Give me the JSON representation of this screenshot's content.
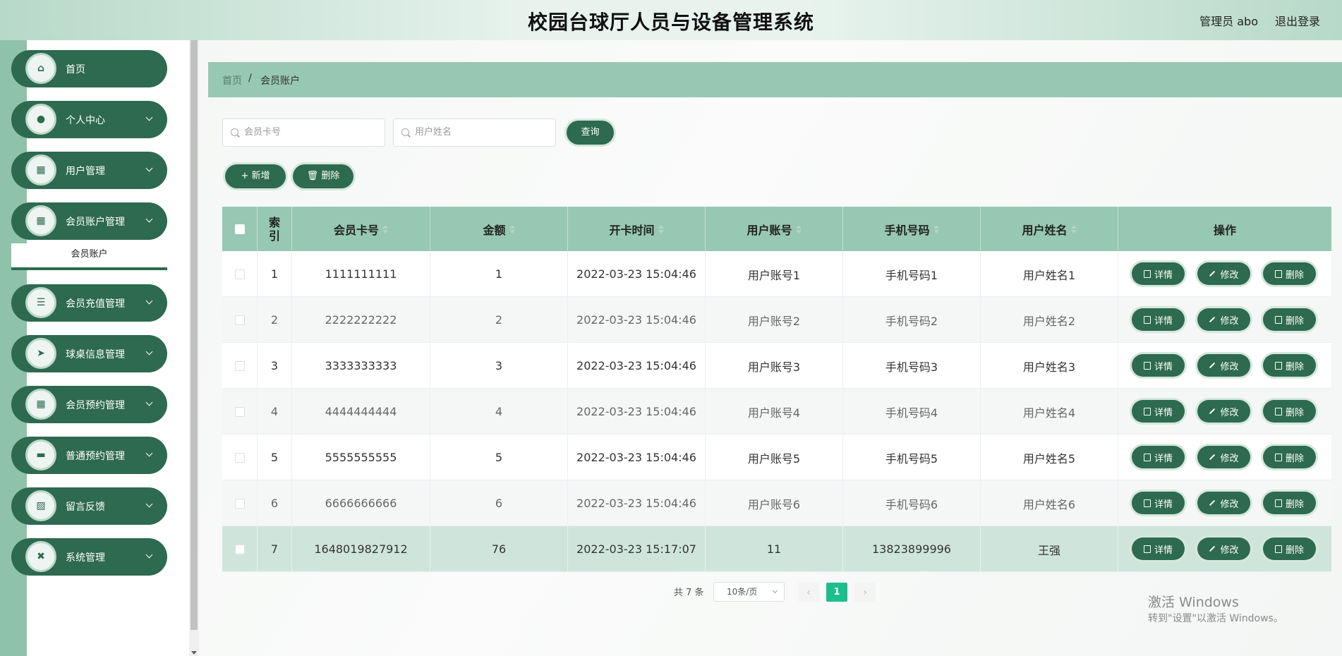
{
  "header": {
    "title": "校园台球厅人员与设备管理系统",
    "admin_label": "管理员 abo",
    "logout": "退出登录"
  },
  "sidebar": {
    "items": [
      {
        "label": "首页",
        "icon": "home-icon",
        "glyph": "⌂",
        "has_children": false
      },
      {
        "label": "个人中心",
        "icon": "user-icon",
        "glyph": "●",
        "has_children": true
      },
      {
        "label": "用户管理",
        "icon": "grid-icon",
        "glyph": "▦",
        "has_children": true
      },
      {
        "label": "会员账户管理",
        "icon": "grid-icon",
        "glyph": "▦",
        "has_children": true
      },
      {
        "label": "会员充值管理",
        "icon": "list-icon",
        "glyph": "☰",
        "has_children": true
      },
      {
        "label": "球桌信息管理",
        "icon": "send-icon",
        "glyph": "➤",
        "has_children": true
      },
      {
        "label": "会员预约管理",
        "icon": "grid-icon",
        "glyph": "▦",
        "has_children": true
      },
      {
        "label": "普通预约管理",
        "icon": "monitor-icon",
        "glyph": "▬",
        "has_children": true
      },
      {
        "label": "留言反馈",
        "icon": "chart-icon",
        "glyph": "▨",
        "has_children": true
      },
      {
        "label": "系统管理",
        "icon": "ticket-icon",
        "glyph": "✖",
        "has_children": true
      }
    ],
    "submenu": {
      "label": "会员账户"
    }
  },
  "breadcrumb": {
    "home": "首页",
    "separator": "/",
    "current": "会员账户"
  },
  "search": {
    "card_placeholder": "会员卡号",
    "name_placeholder": "用户姓名",
    "query_button": "查询"
  },
  "toolbar": {
    "add_label": "新增",
    "delete_label": "删除"
  },
  "table": {
    "columns": [
      "索引",
      "会员卡号",
      "金额",
      "开卡时间",
      "用户账号",
      "手机号码",
      "用户姓名",
      "操作"
    ],
    "rows": [
      [
        "1",
        "1111111111",
        "1",
        "2022-03-23 15:04:46",
        "用户账号1",
        "手机号码1",
        "用户姓名1"
      ],
      [
        "2",
        "2222222222",
        "2",
        "2022-03-23 15:04:46",
        "用户账号2",
        "手机号码2",
        "用户姓名2"
      ],
      [
        "3",
        "3333333333",
        "3",
        "2022-03-23 15:04:46",
        "用户账号3",
        "手机号码3",
        "用户姓名3"
      ],
      [
        "4",
        "4444444444",
        "4",
        "2022-03-23 15:04:46",
        "用户账号4",
        "手机号码4",
        "用户姓名4"
      ],
      [
        "5",
        "5555555555",
        "5",
        "2022-03-23 15:04:46",
        "用户账号5",
        "手机号码5",
        "用户姓名5"
      ],
      [
        "6",
        "6666666666",
        "6",
        "2022-03-23 15:04:46",
        "用户账号6",
        "手机号码6",
        "用户姓名6"
      ],
      [
        "7",
        "1648019827912",
        "76",
        "2022-03-23 15:17:07",
        "11",
        "13823899996",
        "王强"
      ]
    ],
    "actions": {
      "detail": "详情",
      "edit": "修改",
      "delete": "删除"
    }
  },
  "pagination": {
    "total": "共 7 条",
    "page_size": "10条/页",
    "current_page": "1"
  },
  "watermark": {
    "line1": "激活 Windows",
    "line2": "转到\"设置\"以激活 Windows。"
  },
  "colors": {
    "primary": "#2d6a4f",
    "header_row": "#96c8b3",
    "active_page": "#1dbf8f"
  }
}
